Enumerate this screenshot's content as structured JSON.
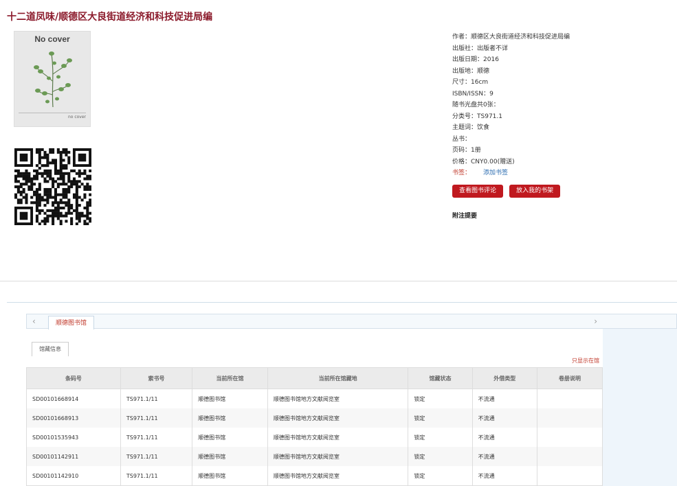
{
  "book": {
    "title": "十二道凤味/顺德区大良街道经济和科技促进局编",
    "cover_text": "No cover",
    "cover_caption": "no cover"
  },
  "info": [
    {
      "label": "作者：",
      "value": "顺德区大良街道经济和科技促进局编"
    },
    {
      "label": "出版社：",
      "value": "出版者不详"
    },
    {
      "label": "出版日期：",
      "value": "2016"
    },
    {
      "label": "出版地：",
      "value": "顺德"
    },
    {
      "label": "尺寸：",
      "value": "16cm"
    },
    {
      "label": "ISBN/ISSN：",
      "value": "9"
    },
    {
      "label": "随书光盘共0张：",
      "value": ""
    },
    {
      "label": "分类号：",
      "value": "TS971.1"
    },
    {
      "label": "主题词：",
      "value": "饮食"
    },
    {
      "label": "丛书：",
      "value": ""
    },
    {
      "label": "页码：",
      "value": "1册"
    },
    {
      "label": "价格：",
      "value": "CNY0.00(赠送)"
    }
  ],
  "bookmark": {
    "label": "书签：",
    "link": "添加书签"
  },
  "buttons": {
    "review": "查看图书评论",
    "shelf": "放入我的书架"
  },
  "note_title": "附注提要",
  "library_tab": "顺德图书馆",
  "holdings_tab": "馆藏信息",
  "only_this": "只显示在馆",
  "table": {
    "headers": [
      "条码号",
      "索书号",
      "当前所在馆",
      "当前所在馆藏地",
      "馆藏状态",
      "外借类型",
      "卷册说明"
    ],
    "rows": [
      [
        "SD00101668914",
        "TS971.1/11",
        "顺德图书馆",
        "顺德图书馆地方文献阅览室",
        "锁定",
        "不流通",
        ""
      ],
      [
        "SD00101668913",
        "TS971.1/11",
        "顺德图书馆",
        "顺德图书馆地方文献阅览室",
        "锁定",
        "不流通",
        ""
      ],
      [
        "SD00101535943",
        "TS971.1/11",
        "顺德图书馆",
        "顺德图书馆地方文献阅览室",
        "锁定",
        "不流通",
        ""
      ],
      [
        "SD00101142911",
        "TS971.1/11",
        "顺德图书馆",
        "顺德图书馆地方文献阅览室",
        "锁定",
        "不流通",
        ""
      ],
      [
        "SD00101142910",
        "TS971.1/11",
        "顺德图书馆",
        "顺德图书馆地方文献阅览室",
        "锁定",
        "不流通",
        ""
      ]
    ]
  },
  "colors": {
    "accent": "#8b1a2b",
    "button": "#c0191f",
    "link": "#2b6cb0"
  }
}
